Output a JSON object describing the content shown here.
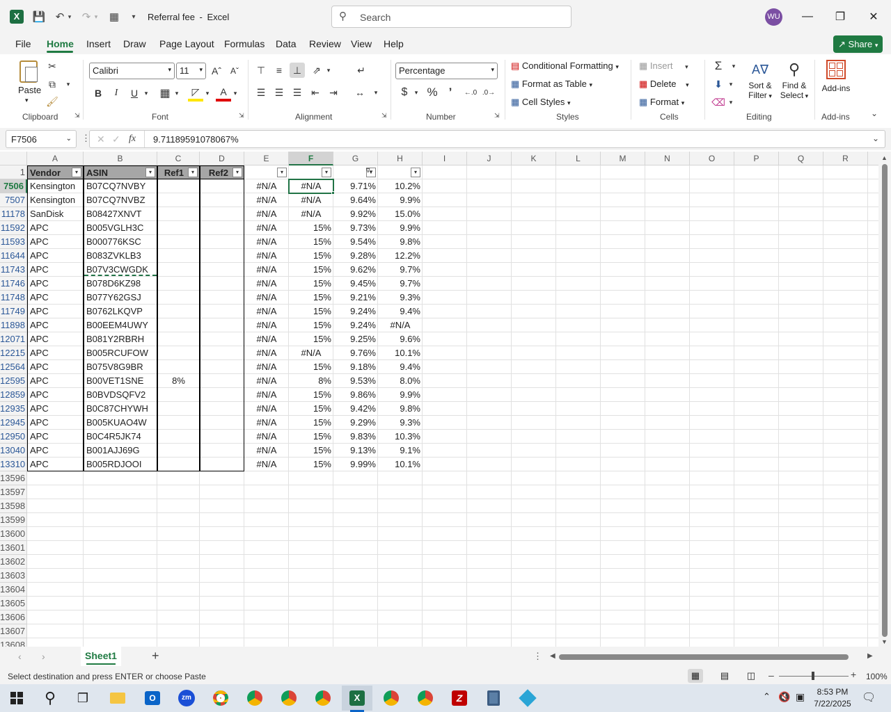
{
  "title": {
    "doc": "Referral fee",
    "sep": "-",
    "app": "Excel",
    "search_placeholder": "Search",
    "avatar": "WU"
  },
  "menu": [
    "File",
    "Home",
    "Insert",
    "Draw",
    "Page Layout",
    "Formulas",
    "Data",
    "Review",
    "View",
    "Help"
  ],
  "share_label": "Share",
  "ribbon": {
    "paste": "Paste",
    "clipboard": "Clipboard",
    "font_name": "Calibri",
    "font_size": "11",
    "font_group": "Font",
    "alignment_group": "Alignment",
    "number_format": "Percentage",
    "number_group": "Number",
    "cond_format": "Conditional Formatting",
    "format_table": "Format as Table",
    "cell_styles": "Cell Styles",
    "styles_group": "Styles",
    "insert": "Insert",
    "delete": "Delete",
    "format": "Format",
    "cells_group": "Cells",
    "sort_filter_1": "Sort &",
    "sort_filter_2": "Filter",
    "find_select_1": "Find &",
    "find_select_2": "Select",
    "editing_group": "Editing",
    "addins": "Add-ins",
    "addins_group": "Add-ins"
  },
  "formula_bar": {
    "name_box": "F7506",
    "formula": "9.71189591078067%",
    "fx": "fx"
  },
  "columns": [
    "A",
    "B",
    "C",
    "D",
    "E",
    "F",
    "G",
    "H",
    "I",
    "J",
    "K",
    "L",
    "M",
    "N",
    "O",
    "P",
    "Q",
    "R"
  ],
  "header_row": {
    "num": "1",
    "A": "Vendor",
    "B": "ASIN",
    "C": "Ref1",
    "D": "Ref2",
    "E": "",
    "F": "",
    "G": "",
    "H": ""
  },
  "rows": [
    {
      "n": "7506",
      "A": "Kensington",
      "B": "B07CQ7NVBY",
      "C": "",
      "E": "#N/A",
      "F": "#N/A",
      "G": "9.71%",
      "H": "10.2%"
    },
    {
      "n": "7507",
      "A": "Kensington",
      "B": "B07CQ7NVBZ",
      "C": "",
      "E": "#N/A",
      "F": "#N/A",
      "G": "9.64%",
      "H": "9.9%"
    },
    {
      "n": "11178",
      "A": "SanDisk",
      "B": "B08427XNVT",
      "C": "",
      "E": "#N/A",
      "F": "#N/A",
      "G": "9.92%",
      "H": "15.0%"
    },
    {
      "n": "11592",
      "A": "APC",
      "B": "B005VGLH3C",
      "C": "",
      "E": "#N/A",
      "F": "15%",
      "G": "9.73%",
      "H": "9.9%"
    },
    {
      "n": "11593",
      "A": "APC",
      "B": "B000776KSC",
      "C": "",
      "E": "#N/A",
      "F": "15%",
      "G": "9.54%",
      "H": "9.8%"
    },
    {
      "n": "11644",
      "A": "APC",
      "B": "B083ZVKLB3",
      "C": "",
      "E": "#N/A",
      "F": "15%",
      "G": "9.28%",
      "H": "12.2%"
    },
    {
      "n": "11743",
      "A": "APC",
      "B": "B07V3CWGDK",
      "C": "",
      "E": "#N/A",
      "F": "15%",
      "G": "9.62%",
      "H": "9.7%"
    },
    {
      "n": "11746",
      "A": "APC",
      "B": "B078D6KZ98",
      "C": "",
      "E": "#N/A",
      "F": "15%",
      "G": "9.45%",
      "H": "9.7%"
    },
    {
      "n": "11748",
      "A": "APC",
      "B": "B077Y62GSJ",
      "C": "",
      "E": "#N/A",
      "F": "15%",
      "G": "9.21%",
      "H": "9.3%"
    },
    {
      "n": "11749",
      "A": "APC",
      "B": "B0762LKQVP",
      "C": "",
      "E": "#N/A",
      "F": "15%",
      "G": "9.24%",
      "H": "9.4%"
    },
    {
      "n": "11898",
      "A": "APC",
      "B": "B00EEM4UWY",
      "C": "",
      "E": "#N/A",
      "F": "15%",
      "G": "9.24%",
      "H": "#N/A"
    },
    {
      "n": "12071",
      "A": "APC",
      "B": "B081Y2RBRH",
      "C": "",
      "E": "#N/A",
      "F": "15%",
      "G": "9.25%",
      "H": "9.6%"
    },
    {
      "n": "12215",
      "A": "APC",
      "B": "B005RCUFOW",
      "C": "",
      "E": "#N/A",
      "F": "#N/A",
      "G": "9.76%",
      "H": "10.1%"
    },
    {
      "n": "12564",
      "A": "APC",
      "B": "B075V8G9BR",
      "C": "",
      "E": "#N/A",
      "F": "15%",
      "G": "9.18%",
      "H": "9.4%"
    },
    {
      "n": "12595",
      "A": "APC",
      "B": "B00VET1SNE",
      "C": "8%",
      "E": "#N/A",
      "F": "8%",
      "G": "9.53%",
      "H": "8.0%"
    },
    {
      "n": "12859",
      "A": "APC",
      "B": "B0BVDSQFV2",
      "C": "",
      "E": "#N/A",
      "F": "15%",
      "G": "9.86%",
      "H": "9.9%"
    },
    {
      "n": "12935",
      "A": "APC",
      "B": "B0C87CHYWH",
      "C": "",
      "E": "#N/A",
      "F": "15%",
      "G": "9.42%",
      "H": "9.8%"
    },
    {
      "n": "12945",
      "A": "APC",
      "B": "B005KUAO4W",
      "C": "",
      "E": "#N/A",
      "F": "15%",
      "G": "9.29%",
      "H": "9.3%"
    },
    {
      "n": "12950",
      "A": "APC",
      "B": "B0C4R5JK74",
      "C": "",
      "E": "#N/A",
      "F": "15%",
      "G": "9.83%",
      "H": "10.3%"
    },
    {
      "n": "13040",
      "A": "APC",
      "B": "B001AJJ69G",
      "C": "",
      "E": "#N/A",
      "F": "15%",
      "G": "9.13%",
      "H": "9.1%"
    },
    {
      "n": "13310",
      "A": "APC",
      "B": "B005RDJOOI",
      "C": "",
      "E": "#N/A",
      "F": "15%",
      "G": "9.99%",
      "H": "10.1%"
    }
  ],
  "empty_rows": [
    "13596",
    "13597",
    "13598",
    "13599",
    "13600",
    "13601",
    "13602",
    "13603",
    "13604",
    "13605",
    "13606",
    "13607",
    "13608"
  ],
  "sheet_tab": "Sheet1",
  "status": {
    "message": "Select destination and press ENTER or choose Paste",
    "zoom": "100%"
  },
  "taskbar": {
    "time": "8:53 PM",
    "date": "7/22/2025"
  },
  "colors": {
    "excel_green": "#217346",
    "share_green": "#1f7a42",
    "avatar": "#7b4fa3",
    "selected_border": "#217346"
  }
}
